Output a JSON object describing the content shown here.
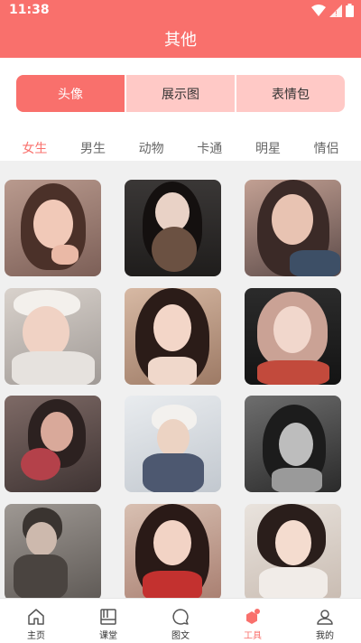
{
  "status_bar": {
    "time": "11:38"
  },
  "header": {
    "title": "其他"
  },
  "segments": [
    {
      "label": "头像",
      "active": true
    },
    {
      "label": "展示图",
      "active": false
    },
    {
      "label": "表情包",
      "active": false
    }
  ],
  "categories": [
    {
      "label": "女生",
      "active": true
    },
    {
      "label": "男生",
      "active": false
    },
    {
      "label": "动物",
      "active": false
    },
    {
      "label": "卡通",
      "active": false
    },
    {
      "label": "明星",
      "active": false
    },
    {
      "label": "情侣",
      "active": false
    }
  ],
  "tabbar": {
    "items": [
      {
        "label": "主页",
        "icon": "home-icon",
        "active": false
      },
      {
        "label": "课堂",
        "icon": "classroom-icon",
        "active": false
      },
      {
        "label": "图文",
        "icon": "chat-icon",
        "active": false
      },
      {
        "label": "工具",
        "icon": "tools-icon",
        "active": true
      },
      {
        "label": "我的",
        "icon": "user-icon",
        "active": false
      }
    ]
  },
  "colors": {
    "accent": "#f9706c",
    "segment_inactive": "#ffc9c6",
    "grid_background": "#f0f0f0"
  }
}
